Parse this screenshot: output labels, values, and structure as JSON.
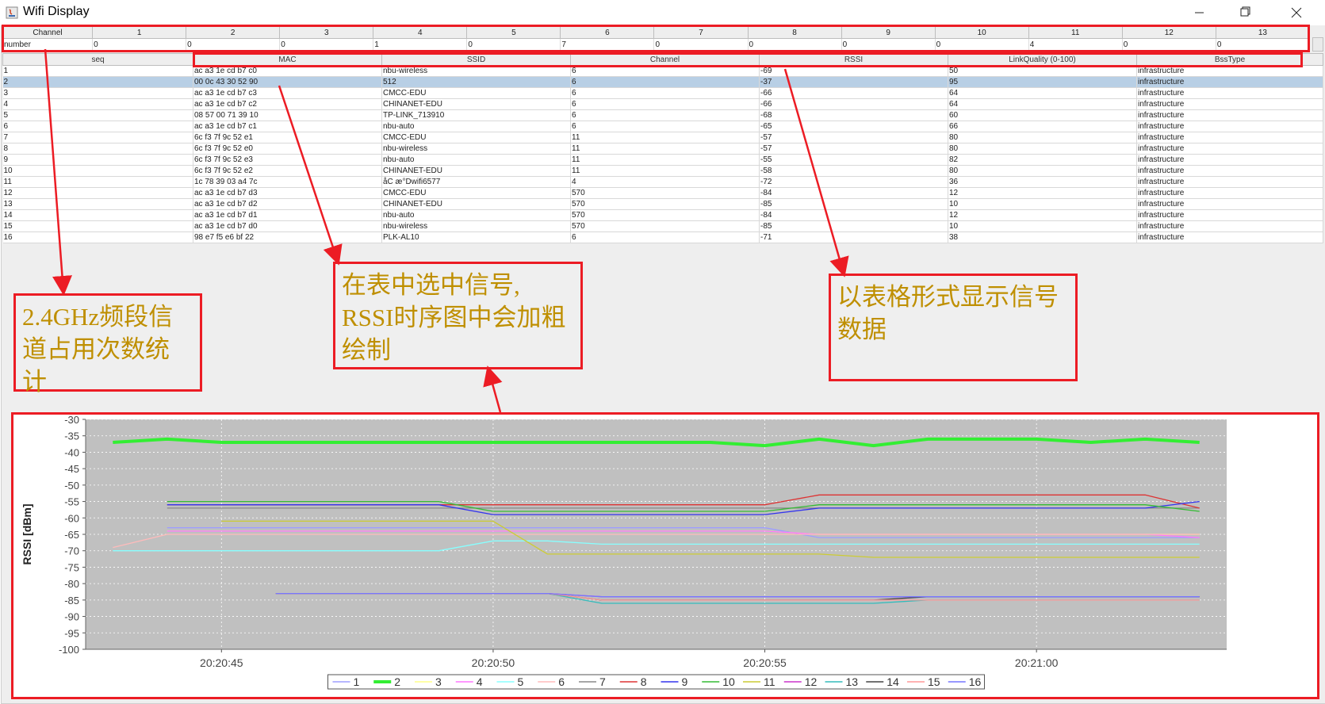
{
  "window": {
    "title": "Wifi Display"
  },
  "channel_table": {
    "headers": [
      "Channel",
      "1",
      "2",
      "3",
      "4",
      "5",
      "6",
      "7",
      "8",
      "9",
      "10",
      "11",
      "12",
      "13"
    ],
    "row": [
      "number",
      "0",
      "0",
      "0",
      "1",
      "0",
      "7",
      "0",
      "0",
      "0",
      "0",
      "4",
      "0",
      "0"
    ]
  },
  "signal_table": {
    "headers": [
      "seq",
      "MAC",
      "SSID",
      "Channel",
      "RSSI",
      "LinkQuality (0-100)",
      "BssType"
    ],
    "selected_index": 1,
    "rows": [
      [
        "1",
        "ac a3 1e cd b7 c0",
        "nbu-wireless",
        "6",
        "-69",
        "50",
        "infrastructure"
      ],
      [
        "2",
        "00 0c 43 30 52 90",
        "512",
        "6",
        "-37",
        "95",
        "infrastructure"
      ],
      [
        "3",
        "ac a3 1e cd b7 c3",
        "CMCC-EDU",
        "6",
        "-66",
        "64",
        "infrastructure"
      ],
      [
        "4",
        "ac a3 1e cd b7 c2",
        "CHINANET-EDU",
        "6",
        "-66",
        "64",
        "infrastructure"
      ],
      [
        "5",
        "08 57 00 71 39 10",
        "TP-LINK_713910",
        "6",
        "-68",
        "60",
        "infrastructure"
      ],
      [
        "6",
        "ac a3 1e cd b7 c1",
        "nbu-auto",
        "6",
        "-65",
        "66",
        "infrastructure"
      ],
      [
        "7",
        "6c f3 7f 9c 52 e1",
        "CMCC-EDU",
        "11",
        "-57",
        "80",
        "infrastructure"
      ],
      [
        "8",
        "6c f3 7f 9c 52 e0",
        "nbu-wireless",
        "11",
        "-57",
        "80",
        "infrastructure"
      ],
      [
        "9",
        "6c f3 7f 9c 52 e3",
        "nbu-auto",
        "11",
        "-55",
        "82",
        "infrastructure"
      ],
      [
        "10",
        "6c f3 7f 9c 52 e2",
        "CHINANET-EDU",
        "11",
        "-58",
        "80",
        "infrastructure"
      ],
      [
        "11",
        "1c 78 39 03 a4 7c",
        "åС æ°Dwifi6577",
        "4",
        "-72",
        "36",
        "infrastructure"
      ],
      [
        "12",
        "ac a3 1e cd b7 d3",
        "CMCC-EDU",
        "570",
        "-84",
        "12",
        "infrastructure"
      ],
      [
        "13",
        "ac a3 1e cd b7 d2",
        "CHINANET-EDU",
        "570",
        "-85",
        "10",
        "infrastructure"
      ],
      [
        "14",
        "ac a3 1e cd b7 d1",
        "nbu-auto",
        "570",
        "-84",
        "12",
        "infrastructure"
      ],
      [
        "15",
        "ac a3 1e cd b7 d0",
        "nbu-wireless",
        "570",
        "-85",
        "10",
        "infrastructure"
      ],
      [
        "16",
        "98 e7 f5 e6 bf 22",
        "PLK-AL10",
        "6",
        "-71",
        "38",
        "infrastructure"
      ]
    ]
  },
  "annotations": {
    "channel_note": "2.4GHz频段信\n道占用次数统计",
    "select_note": "在表中选中信号,\nRSSI时序图中会加粗\n绘制",
    "table_note": "以表格形式显示信号\n数据"
  },
  "colors": {
    "accent_red": "#ec1c24",
    "note_text": "#bf8f00",
    "plot_bg": "#c0c0c0",
    "selected_row": "#b8cfe5"
  },
  "chart_data": {
    "type": "line",
    "ylabel": "RSSI [dBm]",
    "xlabel": "",
    "ylim": [
      -100,
      -30
    ],
    "yticks": [
      -30,
      -35,
      -40,
      -45,
      -50,
      -55,
      -60,
      -65,
      -70,
      -75,
      -80,
      -85,
      -90,
      -95,
      -100
    ],
    "x_tick_labels": [
      "20:20:45",
      "20:20:50",
      "20:20:55",
      "20:21:00"
    ],
    "x_tick_seconds": [
      45,
      50,
      55,
      60
    ],
    "x_range_seconds": [
      42.5,
      63.5
    ],
    "x": [
      43,
      44,
      45,
      46,
      47,
      48,
      49,
      50,
      51,
      52,
      53,
      54,
      55,
      56,
      57,
      58,
      59,
      60,
      61,
      62,
      63
    ],
    "bold_series": "2",
    "series": [
      {
        "name": "1",
        "color": "#9d9dff",
        "values": [
          null,
          -63,
          -63,
          -63,
          -63,
          -63,
          -63,
          -63,
          -63,
          -63,
          -63,
          -63,
          -63,
          -66,
          -66,
          -66,
          -66,
          -66,
          -66,
          -66,
          -66
        ]
      },
      {
        "name": "2",
        "color": "#33ee33",
        "values": [
          -37,
          -36,
          -37,
          -37,
          -37,
          -37,
          -37,
          -37,
          -37,
          -37,
          -37,
          -37,
          -38,
          -36,
          -38,
          -36,
          -36,
          -36,
          -37,
          -36,
          -37
        ]
      },
      {
        "name": "3",
        "color": "#ffff88",
        "values": [
          null,
          -64,
          -64,
          -64,
          -64,
          -64,
          -64,
          -64,
          -64,
          -64,
          -64,
          -64,
          -64,
          -65,
          -65,
          -65,
          -65,
          -65,
          -65,
          -65,
          -65
        ]
      },
      {
        "name": "4",
        "color": "#ff77ff",
        "values": [
          null,
          -64,
          -64,
          -64,
          -64,
          -64,
          -64,
          -64,
          -64,
          -64,
          -64,
          -64,
          -64,
          -65,
          -65,
          -65,
          -65,
          -65,
          -65,
          -65,
          -66
        ]
      },
      {
        "name": "5",
        "color": "#88ffff",
        "values": [
          -70,
          -70,
          -70,
          -70,
          -70,
          -70,
          -70,
          -67,
          -67,
          -68,
          -68,
          -68,
          -68,
          -68,
          -68,
          -68,
          -68,
          -68,
          -68,
          -68,
          -68
        ]
      },
      {
        "name": "6",
        "color": "#ffbbbb",
        "values": [
          -69,
          -65,
          -65,
          -65,
          -65,
          -65,
          -65,
          -65,
          -65,
          -65,
          -65,
          -65,
          -65,
          -65,
          -65,
          -65,
          -65,
          -65,
          -65,
          -65,
          -65
        ]
      },
      {
        "name": "7",
        "color": "#888888",
        "values": [
          null,
          -57,
          -57,
          -57,
          -57,
          -57,
          -57,
          -57,
          -57,
          -57,
          -57,
          -57,
          -57,
          -57,
          -57,
          -57,
          -57,
          -57,
          -57,
          -57,
          -57
        ]
      },
      {
        "name": "8",
        "color": "#dd3333",
        "values": [
          null,
          -56,
          -56,
          -56,
          -56,
          -56,
          -56,
          -56,
          -56,
          -56,
          -56,
          -56,
          -56,
          -53,
          -53,
          -53,
          -53,
          -53,
          -53,
          -53,
          -57
        ]
      },
      {
        "name": "9",
        "color": "#3333ee",
        "values": [
          null,
          -56,
          -56,
          -56,
          -56,
          -56,
          -56,
          -59,
          -59,
          -59,
          -59,
          -59,
          -59,
          -57,
          -57,
          -57,
          -57,
          -57,
          -57,
          -57,
          -55
        ]
      },
      {
        "name": "10",
        "color": "#33bb33",
        "values": [
          null,
          -55,
          -55,
          -55,
          -55,
          -55,
          -55,
          -58,
          -58,
          -58,
          -58,
          -58,
          -58,
          -56,
          -56,
          -56,
          -56,
          -56,
          -56,
          -56,
          -58
        ]
      },
      {
        "name": "11",
        "color": "#cccc33",
        "values": [
          null,
          null,
          -61,
          -61,
          -61,
          -61,
          -61,
          -61,
          -71,
          -71,
          -71,
          -71,
          -71,
          -71,
          -72,
          -72,
          -72,
          -72,
          -72,
          -72,
          -72
        ]
      },
      {
        "name": "12",
        "color": "#cc33cc",
        "values": [
          null,
          null,
          null,
          -83,
          -83,
          -83,
          -83,
          -83,
          -83,
          -84,
          -84,
          -84,
          -84,
          -84,
          -84,
          -84,
          -84,
          -84,
          -84,
          -84,
          -84
        ]
      },
      {
        "name": "13",
        "color": "#33bbbb",
        "values": [
          null,
          null,
          null,
          -83,
          -83,
          -83,
          -83,
          -83,
          -83,
          -86,
          -86,
          -86,
          -86,
          -86,
          -86,
          -85,
          -85,
          -85,
          -85,
          -85,
          -85
        ]
      },
      {
        "name": "14",
        "color": "#444444",
        "values": [
          null,
          null,
          null,
          -83,
          -83,
          -83,
          -83,
          -83,
          -83,
          -85,
          -85,
          -85,
          -85,
          -85,
          -85,
          -84,
          -84,
          -84,
          -84,
          -84,
          -84
        ]
      },
      {
        "name": "15",
        "color": "#ff9999",
        "values": [
          null,
          null,
          null,
          -83,
          -83,
          -83,
          -83,
          -83,
          -83,
          -85,
          -85,
          -85,
          -85,
          -85,
          -85,
          -85,
          -85,
          -85,
          -85,
          -85,
          -85
        ]
      },
      {
        "name": "16",
        "color": "#7777ff",
        "values": [
          null,
          null,
          null,
          -83,
          -83,
          -83,
          -83,
          -83,
          -83,
          -84,
          -84,
          -84,
          -84,
          -84,
          -84,
          -84,
          -84,
          -84,
          -84,
          -84,
          -84
        ]
      }
    ]
  }
}
